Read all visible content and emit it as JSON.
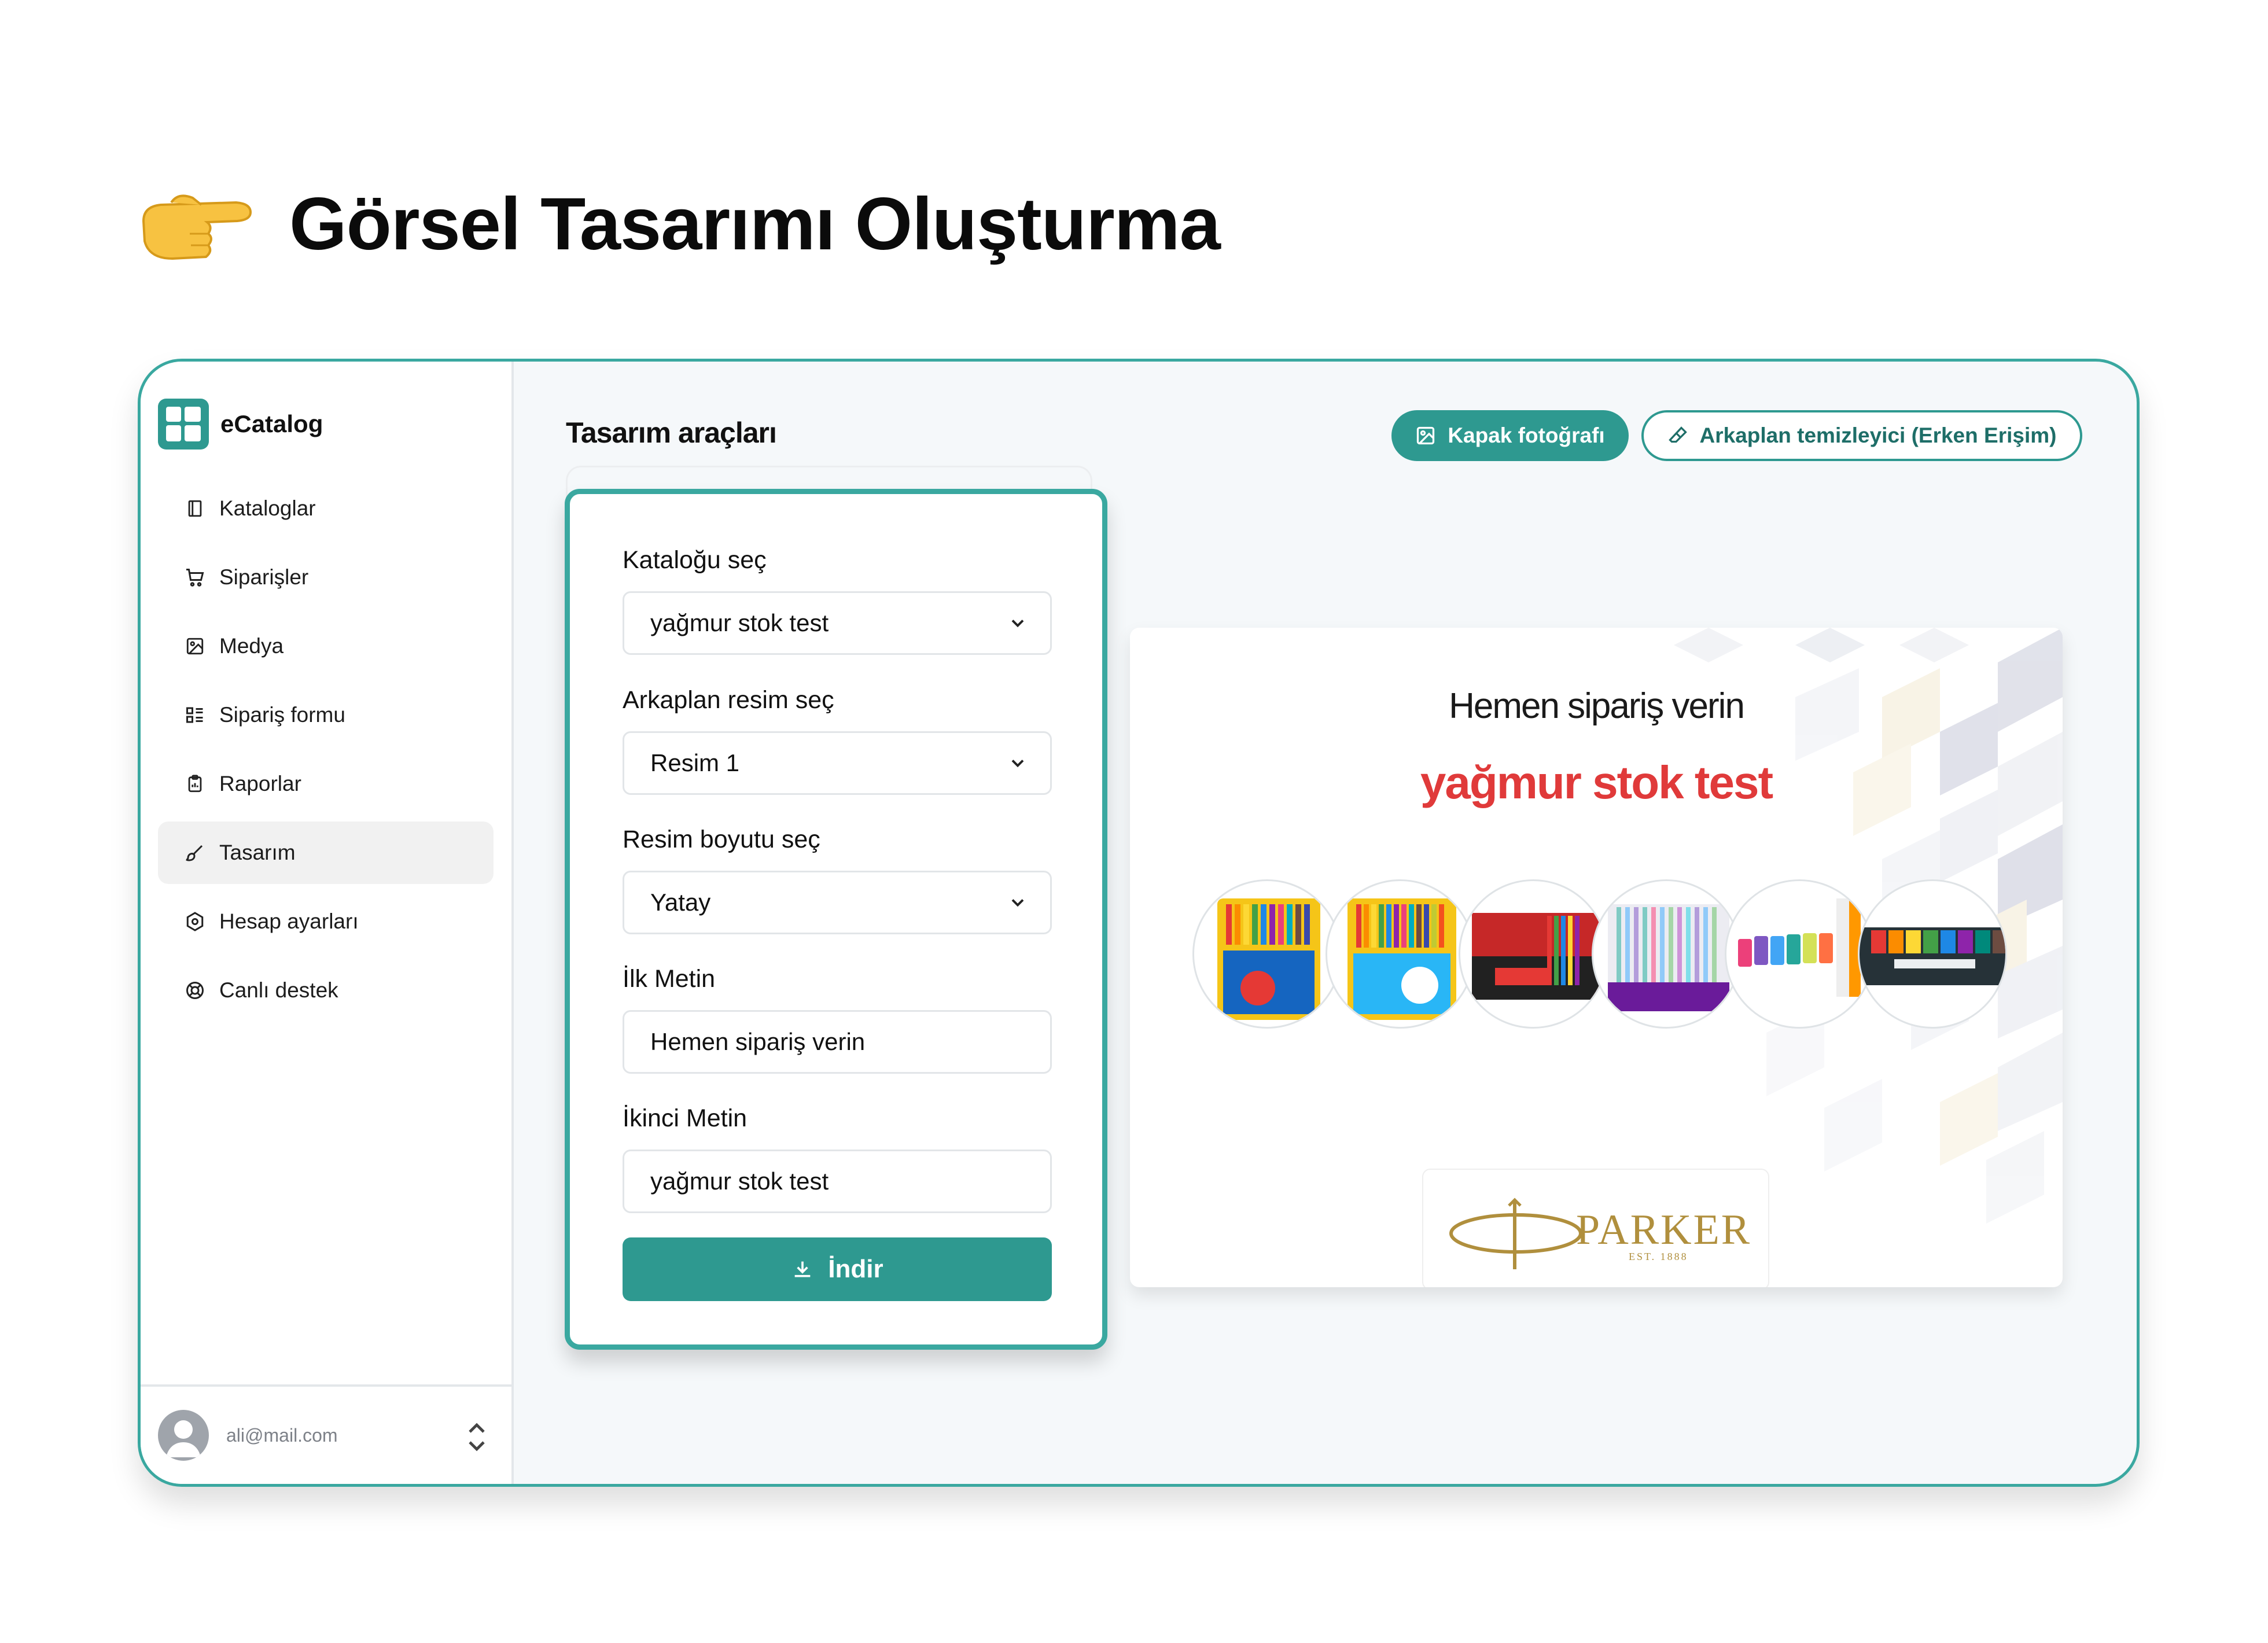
{
  "hero": {
    "title": "Görsel Tasarımı Oluşturma",
    "icon": "pointing-hand-icon"
  },
  "brand": {
    "name": "eCatalog"
  },
  "sidebar": {
    "items": [
      {
        "label": "Kataloglar",
        "icon": "book-icon"
      },
      {
        "label": "Siparişler",
        "icon": "cart-icon"
      },
      {
        "label": "Medya",
        "icon": "image-icon"
      },
      {
        "label": "Sipariş formu",
        "icon": "list-icon"
      },
      {
        "label": "Raporlar",
        "icon": "clipboard-icon"
      },
      {
        "label": "Tasarım",
        "icon": "brush-icon",
        "active": true
      },
      {
        "label": "Hesap ayarları",
        "icon": "settings-icon"
      },
      {
        "label": "Canlı destek",
        "icon": "lifebuoy-icon"
      }
    ]
  },
  "user": {
    "email": "ali@mail.com"
  },
  "main": {
    "title": "Tasarım araçları",
    "cover_button": "Kapak fotoğrafı",
    "bg_remover_button": "Arkaplan temizleyici (Erken Erişim)"
  },
  "form": {
    "catalog": {
      "label": "Kataloğu seç",
      "value": "yağmur stok test"
    },
    "background": {
      "label": "Arkaplan resim seç",
      "value": "Resim 1"
    },
    "size": {
      "label": "Resim boyutu seç",
      "value": "Yatay"
    },
    "first_text": {
      "label": "İlk Metin",
      "value": "Hemen sipariş verin"
    },
    "second_text": {
      "label": "İkinci Metin",
      "value": "yağmur stok test"
    },
    "download": "İndir"
  },
  "preview": {
    "headline": "Hemen sipariş verin",
    "subheadline": "yağmur stok test",
    "brand_word": "PARKER",
    "brand_est": "EST. 1888",
    "accent_color": "#e03a3a"
  },
  "colors": {
    "primary": "#2e9990",
    "border": "#3aa8a0"
  }
}
